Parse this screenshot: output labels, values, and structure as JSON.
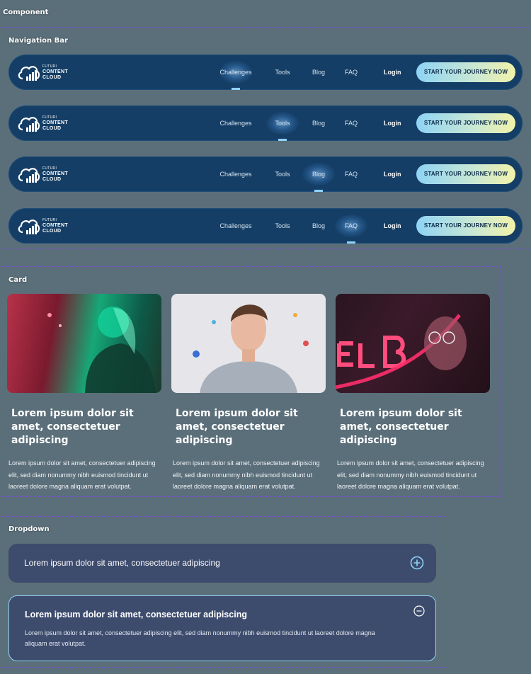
{
  "section_labels": {
    "component": "Component",
    "navigation_bar": "Navigation Bar",
    "card": "Card",
    "dropdown": "Dropdown"
  },
  "nav": {
    "logo_line1": "FUTURI",
    "logo_line2": "CONTENT",
    "logo_line3": "CLOUD",
    "links": [
      "Challenges",
      "Tools",
      "Blog",
      "FAQ"
    ],
    "login": "Login",
    "cta": "START YOUR JOURNEY NOW",
    "accent": "#8fd3ff"
  },
  "cards": [
    {
      "title": "Lorem ipsum dolor sit amet, consectetuer adipiscing",
      "body": "Lorem ipsum dolor sit amet, consectetuer adipiscing elit, sed diam nonummy nibh euismod tincidunt ut laoreet dolore magna aliquam erat volutpat."
    },
    {
      "title": "Lorem ipsum dolor sit amet, consectetuer adipiscing",
      "body": "Lorem ipsum dolor sit amet, consectetuer adipiscing elit, sed diam nonummy nibh euismod tincidunt ut laoreet dolore magna aliquam erat volutpat."
    },
    {
      "title": "Lorem ipsum dolor sit amet, consectetuer adipiscing",
      "body": "Lorem ipsum dolor sit amet, consectetuer adipiscing elit, sed diam nonummy nibh euismod tincidunt ut laoreet dolore magna aliquam erat volutpat."
    }
  ],
  "dropdown": {
    "collapsed_question": "Lorem ipsum dolor sit amet, consectetuer adipiscing",
    "expanded_question": "Lorem ipsum dolor sit amet, consectetuer adipiscing",
    "expanded_answer": "Lorem ipsum dolor sit amet, consectetuer adipiscing elit, sed diam nonummy nibh euismod tincidunt ut laoreet dolore magna aliquam erat volutpat.",
    "expand_icon": "plus-circle-icon",
    "collapse_icon": "minus-circle-icon"
  }
}
